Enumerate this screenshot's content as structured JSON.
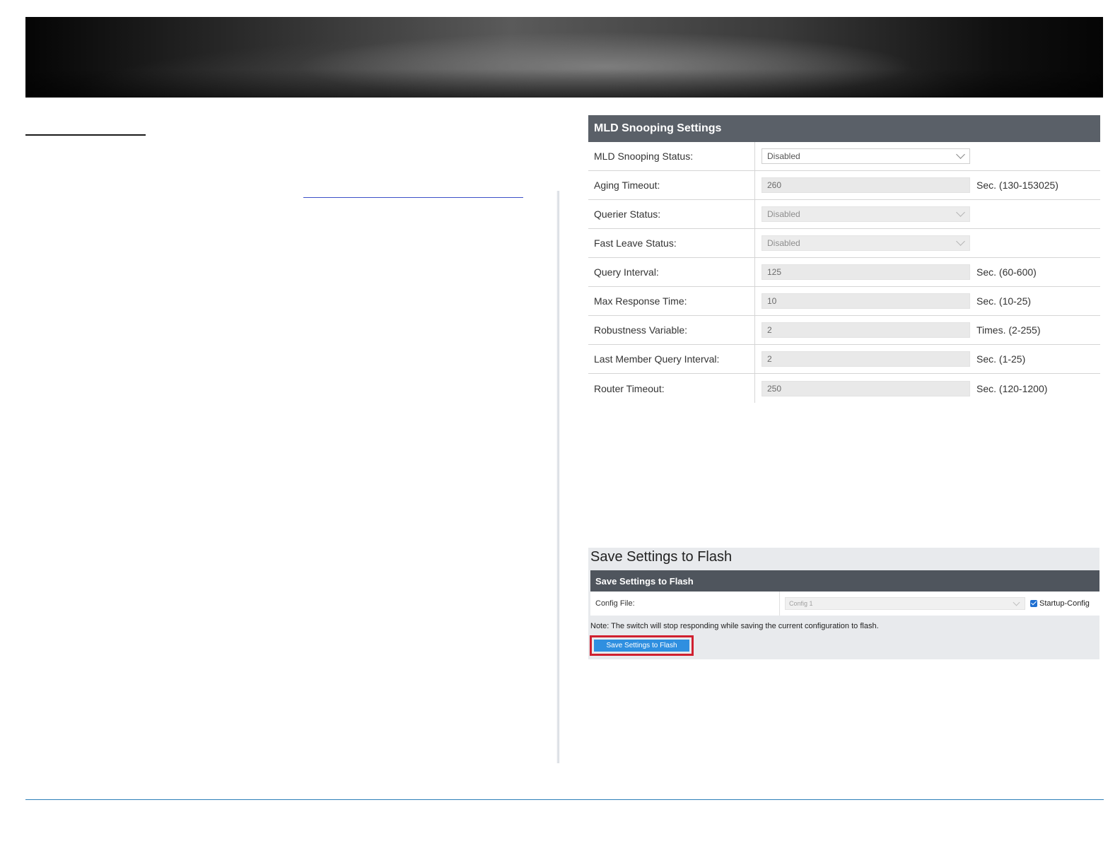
{
  "mld_panel": {
    "title": "MLD Snooping Settings",
    "rows": [
      {
        "label": "MLD Snooping Status:",
        "type": "select",
        "value": "Disabled",
        "disabled": false,
        "unit": ""
      },
      {
        "label": "Aging Timeout:",
        "type": "input",
        "value": "260",
        "unit": "Sec. (130-153025)"
      },
      {
        "label": "Querier Status:",
        "type": "select",
        "value": "Disabled",
        "disabled": true,
        "unit": ""
      },
      {
        "label": "Fast Leave Status:",
        "type": "select",
        "value": "Disabled",
        "disabled": true,
        "unit": ""
      },
      {
        "label": "Query Interval:",
        "type": "input",
        "value": "125",
        "unit": "Sec. (60-600)"
      },
      {
        "label": "Max Response Time:",
        "type": "input",
        "value": "10",
        "unit": "Sec. (10-25)"
      },
      {
        "label": "Robustness Variable:",
        "type": "input",
        "value": "2",
        "unit": "Times. (2-255)"
      },
      {
        "label": "Last Member Query Interval:",
        "type": "input",
        "value": "2",
        "unit": "Sec. (1-25)"
      },
      {
        "label": "Router Timeout:",
        "type": "input",
        "value": "250",
        "unit": "Sec. (120-1200)"
      }
    ]
  },
  "save_panel": {
    "title": "Save Settings to Flash",
    "header": "Save Settings to Flash",
    "config_label": "Config File:",
    "config_value": "Config 1",
    "startup_label": "Startup-Config",
    "startup_checked": true,
    "note": "Note: The switch will stop responding while saving the current configuration to flash.",
    "button_label": "Save Settings to Flash"
  },
  "colors": {
    "panel_header": "#5a6068",
    "button": "#2f8fe0",
    "highlight": "#d0202f",
    "rule": "#2c7fb8"
  }
}
